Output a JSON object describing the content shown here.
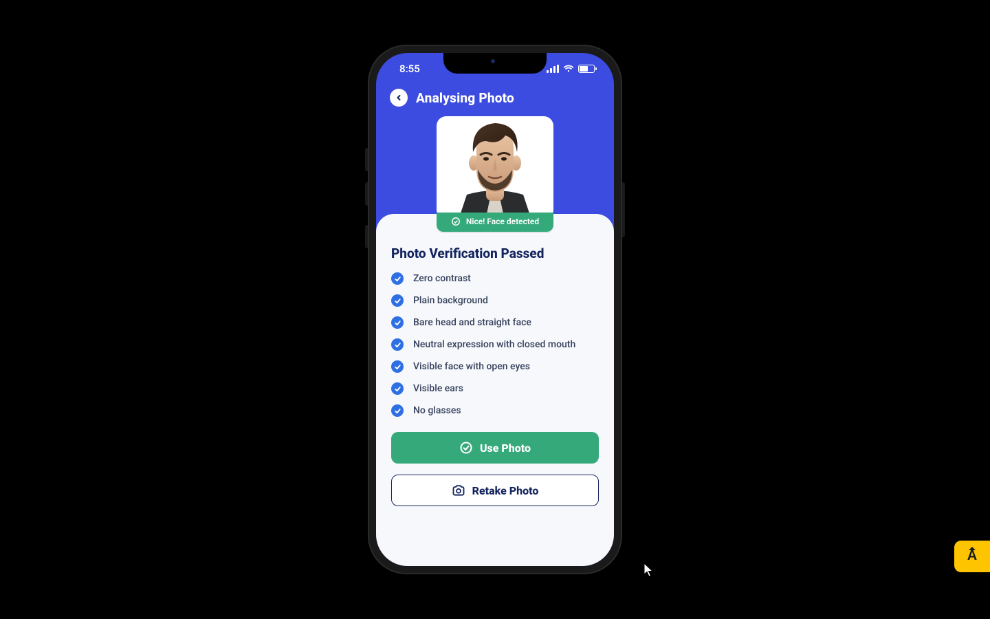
{
  "status": {
    "time": "8:55"
  },
  "header": {
    "title": "Analysing Photo"
  },
  "badge": {
    "text": "Nice! Face detected"
  },
  "sheet": {
    "title": "Photo Verification Passed",
    "checks": [
      "Zero contrast",
      "Plain background",
      "Bare head and straight face",
      "Neutral expression with closed mouth",
      "Visible face with open eyes",
      "Visible ears",
      "No glasses"
    ]
  },
  "buttons": {
    "primary": "Use Photo",
    "secondary": "Retake Photo"
  },
  "fab": {
    "label": "A"
  }
}
